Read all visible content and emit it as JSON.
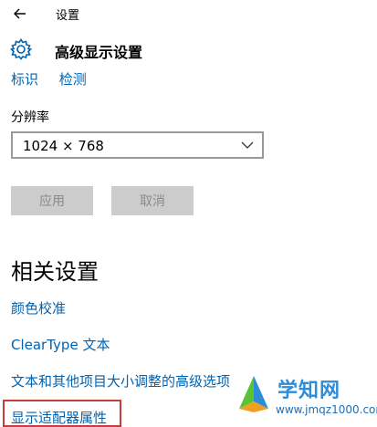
{
  "titlebar": {
    "app_title": "设置"
  },
  "header": {
    "page_title": "高级显示设置"
  },
  "top_links": [
    "标识",
    "检测"
  ],
  "resolution": {
    "label": "分辨率",
    "value": "1024 × 768"
  },
  "buttons": {
    "apply": "应用",
    "cancel": "取消"
  },
  "related": {
    "title": "相关设置",
    "links": [
      "颜色校准",
      "ClearType 文本",
      "文本和其他项目大小调整的高级选项",
      "显示适配器属性"
    ]
  },
  "watermark": {
    "title": "学知网",
    "url": "www.jmqz1000.com"
  },
  "colors": {
    "link": "#0063b1",
    "highlight_border": "#c83c3c",
    "button_bg": "#cccccc"
  },
  "icons": [
    "back-arrow-icon",
    "gear-icon",
    "chevron-down-icon"
  ]
}
